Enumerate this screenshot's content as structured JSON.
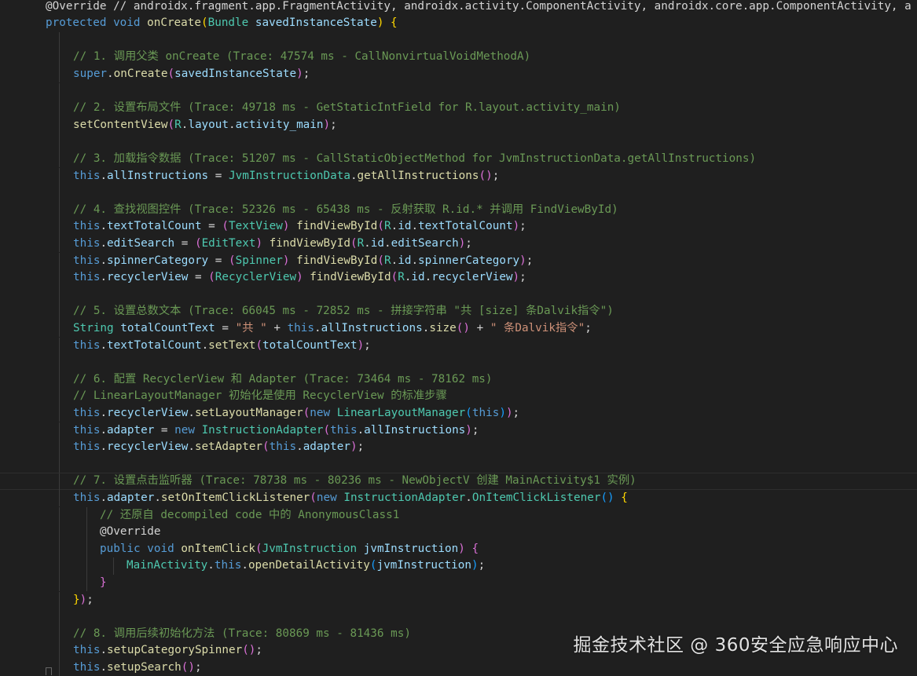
{
  "editor": {
    "lines": [
      [
        {
          "t": "@Override // androidx.fragment.app.FragmentActivity, androidx.activity.ComponentActivity, androidx.core.app.ComponentActivity, a",
          "c": "an"
        }
      ],
      [
        {
          "t": "protected",
          "c": "kw"
        },
        {
          "t": " ",
          "c": "pn"
        },
        {
          "t": "void",
          "c": "kw"
        },
        {
          "t": " ",
          "c": "pn"
        },
        {
          "t": "onCreate",
          "c": "fn"
        },
        {
          "t": "(",
          "c": "b1"
        },
        {
          "t": "Bundle",
          "c": "ty"
        },
        {
          "t": " savedInstanceState",
          "c": "vr"
        },
        {
          "t": ")",
          "c": "b1"
        },
        {
          "t": " ",
          "c": "pn"
        },
        {
          "t": "{",
          "c": "b1"
        }
      ],
      [],
      [
        {
          "t": "// 1. 调用父类 onCreate (Trace: 47574 ms - CallNonvirtualVoidMethodA)",
          "c": "cm"
        }
      ],
      [
        {
          "t": "super",
          "c": "kw"
        },
        {
          "t": ".",
          "c": "pn"
        },
        {
          "t": "onCreate",
          "c": "fn"
        },
        {
          "t": "(",
          "c": "b2"
        },
        {
          "t": "savedInstanceState",
          "c": "vr"
        },
        {
          "t": ")",
          "c": "b2"
        },
        {
          "t": ";",
          "c": "pn"
        }
      ],
      [],
      [
        {
          "t": "// 2. 设置布局文件 (Trace: 49718 ms - GetStaticIntField for R.layout.activity_main)",
          "c": "cm"
        }
      ],
      [
        {
          "t": "setContentView",
          "c": "fn"
        },
        {
          "t": "(",
          "c": "b2"
        },
        {
          "t": "R",
          "c": "ty"
        },
        {
          "t": ".",
          "c": "pn"
        },
        {
          "t": "layout",
          "c": "vr"
        },
        {
          "t": ".",
          "c": "pn"
        },
        {
          "t": "activity_main",
          "c": "vr"
        },
        {
          "t": ")",
          "c": "b2"
        },
        {
          "t": ";",
          "c": "pn"
        }
      ],
      [],
      [
        {
          "t": "// 3. 加载指令数据 (Trace: 51207 ms - CallStaticObjectMethod for JvmInstructionData.getAllInstructions)",
          "c": "cm"
        }
      ],
      [
        {
          "t": "this",
          "c": "kw"
        },
        {
          "t": ".",
          "c": "pn"
        },
        {
          "t": "allInstructions",
          "c": "vr"
        },
        {
          "t": " = ",
          "c": "pn"
        },
        {
          "t": "JvmInstructionData",
          "c": "ty"
        },
        {
          "t": ".",
          "c": "pn"
        },
        {
          "t": "getAllInstructions",
          "c": "fn"
        },
        {
          "t": "()",
          "c": "b2"
        },
        {
          "t": ";",
          "c": "pn"
        }
      ],
      [],
      [
        {
          "t": "// 4. 查找视图控件 (Trace: 52326 ms - 65438 ms - 反射获取 R.id.* 并调用 FindViewById)",
          "c": "cm"
        }
      ],
      [
        {
          "t": "this",
          "c": "kw"
        },
        {
          "t": ".",
          "c": "pn"
        },
        {
          "t": "textTotalCount",
          "c": "vr"
        },
        {
          "t": " = ",
          "c": "pn"
        },
        {
          "t": "(",
          "c": "b2"
        },
        {
          "t": "TextView",
          "c": "ty"
        },
        {
          "t": ")",
          "c": "b2"
        },
        {
          "t": " ",
          "c": "pn"
        },
        {
          "t": "findViewById",
          "c": "fn"
        },
        {
          "t": "(",
          "c": "b2"
        },
        {
          "t": "R",
          "c": "ty"
        },
        {
          "t": ".",
          "c": "pn"
        },
        {
          "t": "id",
          "c": "vr"
        },
        {
          "t": ".",
          "c": "pn"
        },
        {
          "t": "textTotalCount",
          "c": "vr"
        },
        {
          "t": ")",
          "c": "b2"
        },
        {
          "t": ";",
          "c": "pn"
        }
      ],
      [
        {
          "t": "this",
          "c": "kw"
        },
        {
          "t": ".",
          "c": "pn"
        },
        {
          "t": "editSearch",
          "c": "vr"
        },
        {
          "t": " = ",
          "c": "pn"
        },
        {
          "t": "(",
          "c": "b2"
        },
        {
          "t": "EditText",
          "c": "ty"
        },
        {
          "t": ")",
          "c": "b2"
        },
        {
          "t": " ",
          "c": "pn"
        },
        {
          "t": "findViewById",
          "c": "fn"
        },
        {
          "t": "(",
          "c": "b2"
        },
        {
          "t": "R",
          "c": "ty"
        },
        {
          "t": ".",
          "c": "pn"
        },
        {
          "t": "id",
          "c": "vr"
        },
        {
          "t": ".",
          "c": "pn"
        },
        {
          "t": "editSearch",
          "c": "vr"
        },
        {
          "t": ")",
          "c": "b2"
        },
        {
          "t": ";",
          "c": "pn"
        }
      ],
      [
        {
          "t": "this",
          "c": "kw"
        },
        {
          "t": ".",
          "c": "pn"
        },
        {
          "t": "spinnerCategory",
          "c": "vr"
        },
        {
          "t": " = ",
          "c": "pn"
        },
        {
          "t": "(",
          "c": "b2"
        },
        {
          "t": "Spinner",
          "c": "ty"
        },
        {
          "t": ")",
          "c": "b2"
        },
        {
          "t": " ",
          "c": "pn"
        },
        {
          "t": "findViewById",
          "c": "fn"
        },
        {
          "t": "(",
          "c": "b2"
        },
        {
          "t": "R",
          "c": "ty"
        },
        {
          "t": ".",
          "c": "pn"
        },
        {
          "t": "id",
          "c": "vr"
        },
        {
          "t": ".",
          "c": "pn"
        },
        {
          "t": "spinnerCategory",
          "c": "vr"
        },
        {
          "t": ")",
          "c": "b2"
        },
        {
          "t": ";",
          "c": "pn"
        }
      ],
      [
        {
          "t": "this",
          "c": "kw"
        },
        {
          "t": ".",
          "c": "pn"
        },
        {
          "t": "recyclerView",
          "c": "vr"
        },
        {
          "t": " = ",
          "c": "pn"
        },
        {
          "t": "(",
          "c": "b2"
        },
        {
          "t": "RecyclerView",
          "c": "ty"
        },
        {
          "t": ")",
          "c": "b2"
        },
        {
          "t": " ",
          "c": "pn"
        },
        {
          "t": "findViewById",
          "c": "fn"
        },
        {
          "t": "(",
          "c": "b2"
        },
        {
          "t": "R",
          "c": "ty"
        },
        {
          "t": ".",
          "c": "pn"
        },
        {
          "t": "id",
          "c": "vr"
        },
        {
          "t": ".",
          "c": "pn"
        },
        {
          "t": "recyclerView",
          "c": "vr"
        },
        {
          "t": ")",
          "c": "b2"
        },
        {
          "t": ";",
          "c": "pn"
        }
      ],
      [],
      [
        {
          "t": "// 5. 设置总数文本 (Trace: 66045 ms - 72852 ms - 拼接字符串 \"共 [size] 条Dalvik指令\")",
          "c": "cm"
        }
      ],
      [
        {
          "t": "String",
          "c": "ty"
        },
        {
          "t": " totalCountText",
          "c": "vr"
        },
        {
          "t": " = ",
          "c": "pn"
        },
        {
          "t": "\"共 \"",
          "c": "str"
        },
        {
          "t": " + ",
          "c": "pn"
        },
        {
          "t": "this",
          "c": "kw"
        },
        {
          "t": ".",
          "c": "pn"
        },
        {
          "t": "allInstructions",
          "c": "vr"
        },
        {
          "t": ".",
          "c": "pn"
        },
        {
          "t": "size",
          "c": "fn"
        },
        {
          "t": "()",
          "c": "b2"
        },
        {
          "t": " + ",
          "c": "pn"
        },
        {
          "t": "\" 条Dalvik指令\"",
          "c": "str"
        },
        {
          "t": ";",
          "c": "pn"
        }
      ],
      [
        {
          "t": "this",
          "c": "kw"
        },
        {
          "t": ".",
          "c": "pn"
        },
        {
          "t": "textTotalCount",
          "c": "vr"
        },
        {
          "t": ".",
          "c": "pn"
        },
        {
          "t": "setText",
          "c": "fn"
        },
        {
          "t": "(",
          "c": "b2"
        },
        {
          "t": "totalCountText",
          "c": "vr"
        },
        {
          "t": ")",
          "c": "b2"
        },
        {
          "t": ";",
          "c": "pn"
        }
      ],
      [],
      [
        {
          "t": "// 6. 配置 RecyclerView 和 Adapter (Trace: 73464 ms - 78162 ms)",
          "c": "cm"
        }
      ],
      [
        {
          "t": "// LinearLayoutManager 初始化是使用 RecyclerView 的标准步骤",
          "c": "cm"
        }
      ],
      [
        {
          "t": "this",
          "c": "kw"
        },
        {
          "t": ".",
          "c": "pn"
        },
        {
          "t": "recyclerView",
          "c": "vr"
        },
        {
          "t": ".",
          "c": "pn"
        },
        {
          "t": "setLayoutManager",
          "c": "fn"
        },
        {
          "t": "(",
          "c": "b2"
        },
        {
          "t": "new",
          "c": "kw"
        },
        {
          "t": " ",
          "c": "pn"
        },
        {
          "t": "LinearLayoutManager",
          "c": "ty"
        },
        {
          "t": "(",
          "c": "b3"
        },
        {
          "t": "this",
          "c": "kw"
        },
        {
          "t": ")",
          "c": "b3"
        },
        {
          "t": ")",
          "c": "b2"
        },
        {
          "t": ";",
          "c": "pn"
        }
      ],
      [
        {
          "t": "this",
          "c": "kw"
        },
        {
          "t": ".",
          "c": "pn"
        },
        {
          "t": "adapter",
          "c": "vr"
        },
        {
          "t": " = ",
          "c": "pn"
        },
        {
          "t": "new",
          "c": "kw"
        },
        {
          "t": " ",
          "c": "pn"
        },
        {
          "t": "InstructionAdapter",
          "c": "ty"
        },
        {
          "t": "(",
          "c": "b2"
        },
        {
          "t": "this",
          "c": "kw"
        },
        {
          "t": ".",
          "c": "pn"
        },
        {
          "t": "allInstructions",
          "c": "vr"
        },
        {
          "t": ")",
          "c": "b2"
        },
        {
          "t": ";",
          "c": "pn"
        }
      ],
      [
        {
          "t": "this",
          "c": "kw"
        },
        {
          "t": ".",
          "c": "pn"
        },
        {
          "t": "recyclerView",
          "c": "vr"
        },
        {
          "t": ".",
          "c": "pn"
        },
        {
          "t": "setAdapter",
          "c": "fn"
        },
        {
          "t": "(",
          "c": "b2"
        },
        {
          "t": "this",
          "c": "kw"
        },
        {
          "t": ".",
          "c": "pn"
        },
        {
          "t": "adapter",
          "c": "vr"
        },
        {
          "t": ")",
          "c": "b2"
        },
        {
          "t": ";",
          "c": "pn"
        }
      ],
      [],
      [
        {
          "t": "// 7. 设置点击监听器 (Trace: 78738 ms - 80236 ms - NewObjectV 创建 MainActivity$1 实例)",
          "c": "cm"
        }
      ],
      [
        {
          "t": "this",
          "c": "kw"
        },
        {
          "t": ".",
          "c": "pn"
        },
        {
          "t": "adapter",
          "c": "vr"
        },
        {
          "t": ".",
          "c": "pn"
        },
        {
          "t": "setOnItemClickListener",
          "c": "fn"
        },
        {
          "t": "(",
          "c": "b2"
        },
        {
          "t": "new",
          "c": "kw"
        },
        {
          "t": " ",
          "c": "pn"
        },
        {
          "t": "InstructionAdapter",
          "c": "ty"
        },
        {
          "t": ".",
          "c": "pn"
        },
        {
          "t": "OnItemClickListener",
          "c": "ty"
        },
        {
          "t": "()",
          "c": "b3"
        },
        {
          "t": " ",
          "c": "pn"
        },
        {
          "t": "{",
          "c": "b1"
        }
      ],
      [
        {
          "t": "// 还原自 decompiled code 中的 AnonymousClass1",
          "c": "cm"
        }
      ],
      [
        {
          "t": "@Override",
          "c": "an"
        }
      ],
      [
        {
          "t": "public",
          "c": "kw"
        },
        {
          "t": " ",
          "c": "pn"
        },
        {
          "t": "void",
          "c": "kw"
        },
        {
          "t": " ",
          "c": "pn"
        },
        {
          "t": "onItemClick",
          "c": "fn"
        },
        {
          "t": "(",
          "c": "b2"
        },
        {
          "t": "JvmInstruction",
          "c": "ty"
        },
        {
          "t": " jvmInstruction",
          "c": "vr"
        },
        {
          "t": ")",
          "c": "b2"
        },
        {
          "t": " ",
          "c": "pn"
        },
        {
          "t": "{",
          "c": "b2"
        }
      ],
      [
        {
          "t": "MainActivity",
          "c": "ty"
        },
        {
          "t": ".",
          "c": "pn"
        },
        {
          "t": "this",
          "c": "kw"
        },
        {
          "t": ".",
          "c": "pn"
        },
        {
          "t": "openDetailActivity",
          "c": "fn"
        },
        {
          "t": "(",
          "c": "b3"
        },
        {
          "t": "jvmInstruction",
          "c": "vr"
        },
        {
          "t": ")",
          "c": "b3"
        },
        {
          "t": ";",
          "c": "pn"
        }
      ],
      [
        {
          "t": "}",
          "c": "b2"
        }
      ],
      [
        {
          "t": "}",
          "c": "b1"
        },
        {
          "t": ")",
          "c": "b2"
        },
        {
          "t": ";",
          "c": "pn"
        }
      ],
      [],
      [
        {
          "t": "// 8. 调用后续初始化方法 (Trace: 80869 ms - 81436 ms)",
          "c": "cm"
        }
      ],
      [
        {
          "t": "this",
          "c": "kw"
        },
        {
          "t": ".",
          "c": "pn"
        },
        {
          "t": "setupCategorySpinner",
          "c": "fn"
        },
        {
          "t": "()",
          "c": "b2"
        },
        {
          "t": ";",
          "c": "pn"
        }
      ],
      [
        {
          "t": "this",
          "c": "kw"
        },
        {
          "t": ".",
          "c": "pn"
        },
        {
          "t": "setupSearch",
          "c": "fn"
        },
        {
          "t": "()",
          "c": "b2"
        },
        {
          "t": ";",
          "c": "pn"
        }
      ]
    ]
  },
  "watermark": {
    "text": "掘金技术社区 @ 360安全应急响应中心"
  }
}
